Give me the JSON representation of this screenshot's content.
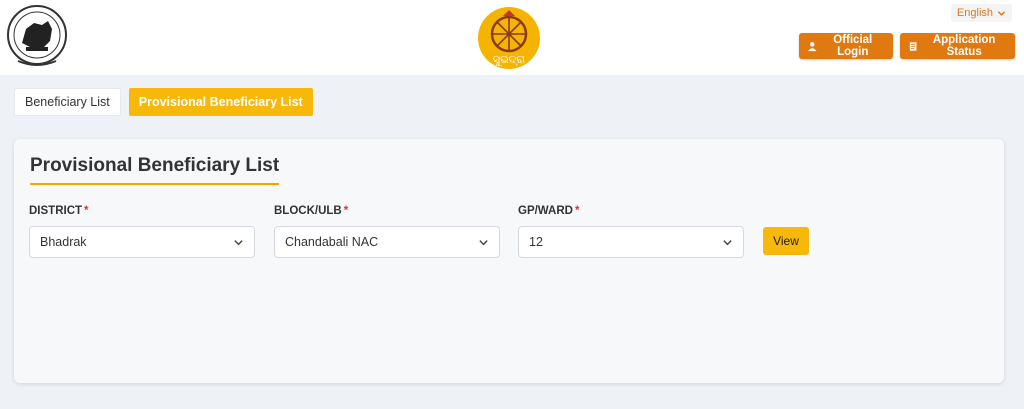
{
  "header": {
    "language": "English",
    "official_login": "Official Login",
    "application_status": "Application Status"
  },
  "tabs": [
    {
      "label": "Beneficiary List",
      "active": false
    },
    {
      "label": "Provisional Beneficiary List",
      "active": true
    }
  ],
  "card": {
    "title": "Provisional Beneficiary List",
    "fields": {
      "district": {
        "label": "DISTRICT",
        "value": "Bhadrak"
      },
      "block": {
        "label": "BLOCK/ULB",
        "value": "Chandabali NAC"
      },
      "gp": {
        "label": "GP/WARD",
        "value": "12"
      }
    },
    "required_marker": "*",
    "view_label": "View"
  },
  "colors": {
    "accent_orange": "#e07a10",
    "accent_yellow": "#f7b80a",
    "required_red": "#d9342b"
  },
  "icons": {
    "emblem": "odisha-emblem-icon",
    "logo": "subhadra-logo-icon",
    "user": "user-icon",
    "document": "document-icon",
    "chevron": "chevron-down-icon"
  }
}
